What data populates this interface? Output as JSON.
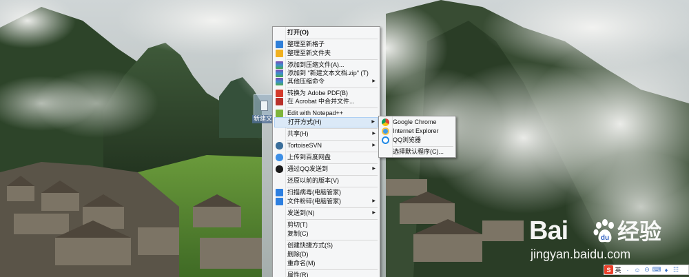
{
  "context_menu": {
    "items": [
      {
        "label": "打开(O)",
        "bold": true
      },
      {
        "label": "整理至新格子",
        "icon": "fences-grid-icon"
      },
      {
        "label": "整理至新文件夹",
        "icon": "folder-icon"
      },
      {
        "label": "添加到压缩文件(A)...",
        "icon": "archive-icon"
      },
      {
        "label": "添加到 \"新建文本文档.zip\" (T)",
        "icon": "archive-icon"
      },
      {
        "label": "其他压缩命令",
        "icon": "archive-icon",
        "submenu": true
      },
      {
        "label": "转换为 Adobe PDF(B)",
        "icon": "pdf-icon"
      },
      {
        "label": "在 Acrobat 中合并文件...",
        "icon": "acrobat-icon"
      },
      {
        "label": "Edit with Notepad++",
        "icon": "notepad-plus-plus-icon"
      },
      {
        "label": "打开方式(H)",
        "submenu": true,
        "highlighted": true
      },
      {
        "label": "共享(H)",
        "submenu": true
      },
      {
        "label": "TortoiseSVN",
        "icon": "tortoise-svn-icon",
        "submenu": true
      },
      {
        "label": "上传到百度网盘",
        "icon": "baidu-netdisk-icon"
      },
      {
        "label": "通过QQ发送到",
        "icon": "qq-icon",
        "submenu": true
      },
      {
        "label": "还原以前的版本(V)"
      },
      {
        "label": "扫描病毒(电脑管家)",
        "icon": "shield-icon"
      },
      {
        "label": "文件粉碎(电脑管家)",
        "icon": "shield-icon",
        "submenu": true
      },
      {
        "label": "发送到(N)",
        "submenu": true
      },
      {
        "label": "剪切(T)"
      },
      {
        "label": "复制(C)"
      },
      {
        "label": "创建快捷方式(S)"
      },
      {
        "label": "删除(D)"
      },
      {
        "label": "重命名(M)"
      },
      {
        "label": "属性(R)"
      }
    ]
  },
  "open_with_submenu": {
    "items": [
      {
        "label": "Google Chrome",
        "icon": "chrome-icon"
      },
      {
        "label": "Internet Explorer",
        "icon": "internet-explorer-icon"
      },
      {
        "label": "QQ浏览器",
        "icon": "qq-browser-icon"
      },
      {
        "label": "选择默认程序(C)..."
      }
    ]
  },
  "desktop": {
    "file_label": "新建文"
  },
  "watermark": {
    "logo_text": "Bai",
    "logo_text_cn": "经验",
    "url": "jingyan.baidu.com"
  },
  "ime_toolbar": {
    "logo": "S",
    "lang": "英",
    "items": [
      "·",
      "☺",
      "⊙",
      "⌨",
      "♦",
      "☷",
      "⚙"
    ]
  },
  "colors": {
    "menu_bg": "#f5f6f7",
    "menu_highlight": "#dbe9f7",
    "ime_logo": "#e8402a"
  }
}
